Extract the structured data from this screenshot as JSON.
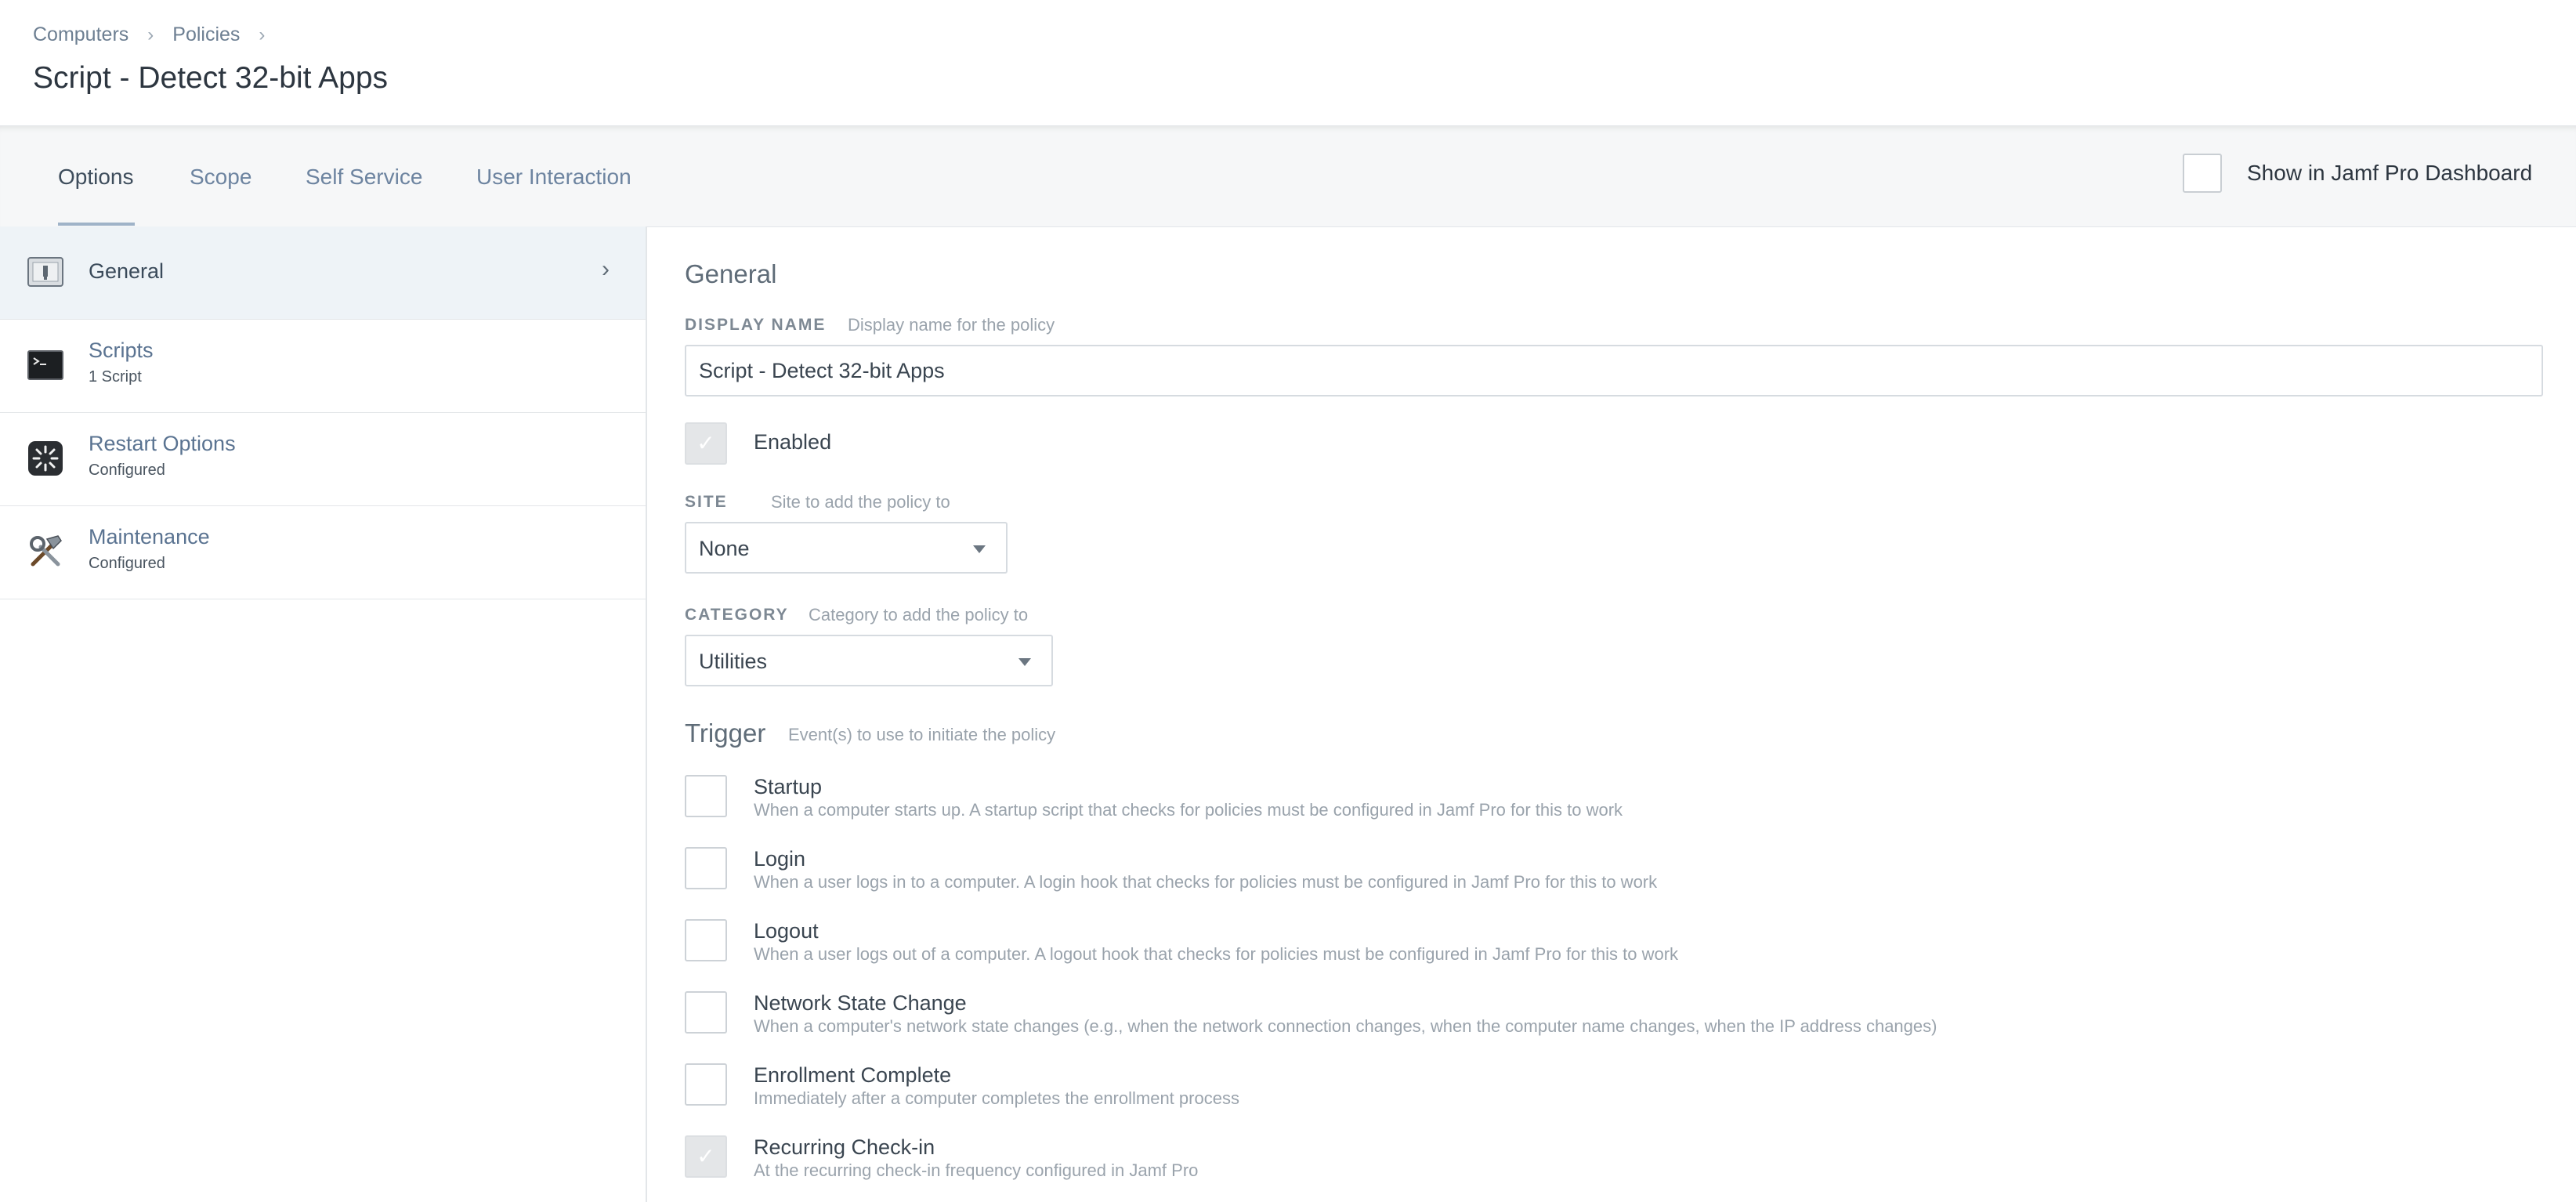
{
  "breadcrumb": {
    "items": [
      "Computers",
      "Policies"
    ]
  },
  "page": {
    "title": "Script - Detect 32-bit Apps"
  },
  "tabs": [
    {
      "label": "Options",
      "active": true
    },
    {
      "label": "Scope"
    },
    {
      "label": "Self Service"
    },
    {
      "label": "User Interaction"
    }
  ],
  "dashboard": {
    "label": "Show in Jamf Pro Dashboard",
    "checked": false
  },
  "sidebar": {
    "items": [
      {
        "label": "General",
        "sub": "",
        "icon": "general-icon",
        "active": true
      },
      {
        "label": "Scripts",
        "sub": "1 Script",
        "icon": "terminal-icon"
      },
      {
        "label": "Restart Options",
        "sub": "Configured",
        "icon": "restart-icon"
      },
      {
        "label": "Maintenance",
        "sub": "Configured",
        "icon": "tools-icon"
      }
    ]
  },
  "general": {
    "title": "General",
    "display_name": {
      "label": "DISPLAY NAME",
      "hint": "Display name for the policy",
      "value": "Script - Detect 32-bit Apps"
    },
    "enabled": {
      "label": "Enabled",
      "checked": true
    },
    "site": {
      "label": "SITE",
      "hint": "Site to add the policy to",
      "value": "None"
    },
    "category": {
      "label": "CATEGORY",
      "hint": "Category to add the policy to",
      "value": "Utilities"
    }
  },
  "trigger": {
    "title": "Trigger",
    "hint": "Event(s) to use to initiate the policy",
    "items": [
      {
        "label": "Startup",
        "desc": "When a computer starts up. A startup script that checks for policies must be configured in Jamf Pro for this to work",
        "checked": false
      },
      {
        "label": "Login",
        "desc": "When a user logs in to a computer. A login hook that checks for policies must be configured in Jamf Pro for this to work",
        "checked": false
      },
      {
        "label": "Logout",
        "desc": "When a user logs out of a computer. A logout hook that checks for policies must be configured in Jamf Pro for this to work",
        "checked": false
      },
      {
        "label": "Network State Change",
        "desc": "When a computer's network state changes (e.g., when the network connection changes, when the computer name changes, when the IP address changes)",
        "checked": false
      },
      {
        "label": "Enrollment Complete",
        "desc": "Immediately after a computer completes the enrollment process",
        "checked": false
      },
      {
        "label": "Recurring Check-in",
        "desc": "At the recurring check-in frequency configured in Jamf Pro",
        "checked": true
      }
    ]
  },
  "colors": {
    "accent": "#9fb3c8",
    "link": "#6d84a0",
    "active_row": "#eef3f7"
  }
}
